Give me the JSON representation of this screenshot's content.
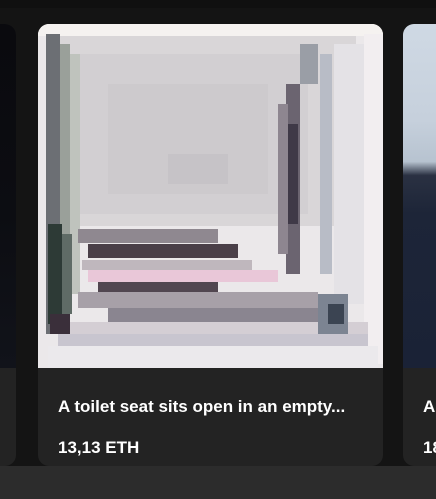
{
  "cards": [
    {
      "title": "",
      "price": ""
    },
    {
      "title": "A toilet seat sits open in an empty...",
      "price": "13,13 ETH"
    },
    {
      "title": "A",
      "price": "18"
    }
  ]
}
